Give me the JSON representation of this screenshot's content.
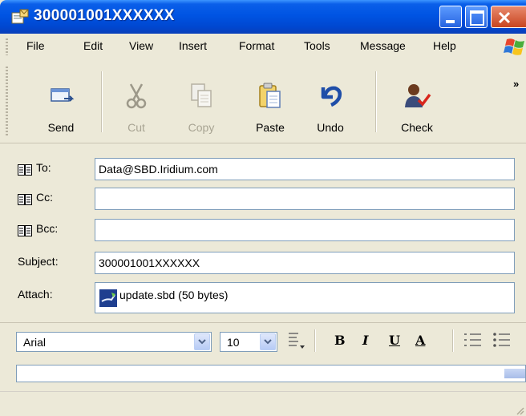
{
  "window": {
    "title": "300001001XXXXXX"
  },
  "menu": [
    "File",
    "Edit",
    "View",
    "Insert",
    "Format",
    "Tools",
    "Message",
    "Help"
  ],
  "toolbar": {
    "send": "Send",
    "cut": "Cut",
    "copy": "Copy",
    "paste": "Paste",
    "undo": "Undo",
    "check": "Check",
    "overflow": "»"
  },
  "headers": {
    "to_label": "To:",
    "to_value": "Data@SBD.Iridium.com",
    "cc_label": "Cc:",
    "cc_value": "",
    "bcc_label": "Bcc:",
    "bcc_value": "",
    "subject_label": "Subject:",
    "subject_value": "300001001XXXXXX",
    "attach_label": "Attach:",
    "attach_value": "update.sbd (50 bytes)"
  },
  "format": {
    "font": "Arial",
    "size": "10",
    "bold": "B",
    "italic": "I",
    "underline": "U",
    "color": "A"
  },
  "colors": {
    "titlebar": "#0054e3",
    "close": "#c8441f",
    "input_border": "#7f9db9"
  }
}
